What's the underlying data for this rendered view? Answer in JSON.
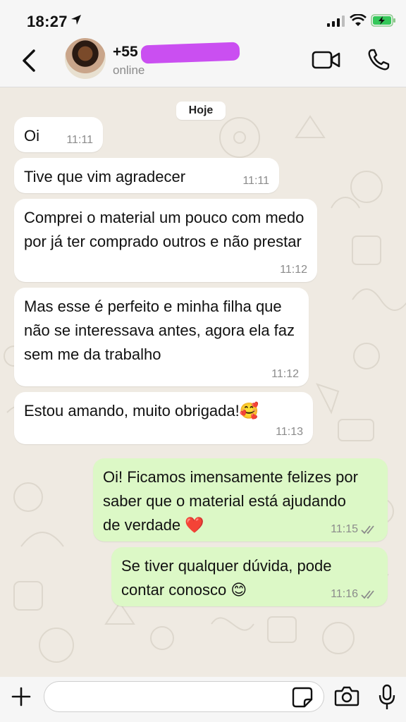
{
  "status_bar": {
    "time": "18:27"
  },
  "header": {
    "contact_name": "+55",
    "contact_status": "online"
  },
  "date_chip": "Hoje",
  "messages": [
    {
      "text": "Oi",
      "time": "11:11",
      "direction": "incoming"
    },
    {
      "text": "Tive que vim agradecer",
      "time": "11:11",
      "direction": "incoming"
    },
    {
      "text": "Comprei o material um pouco com medo por já ter comprado outros e não prestar",
      "time": "11:12",
      "direction": "incoming"
    },
    {
      "text": "Mas esse é perfeito e minha filha que não se interessava antes, agora ela faz sem me da trabalho",
      "time": "11:12",
      "direction": "incoming"
    },
    {
      "text": "Estou amando, muito obrigada!🥰",
      "time": "11:13",
      "direction": "incoming"
    },
    {
      "text": "Oi! Ficamos imensamente felizes por saber que o material está ajudando de verdade ❤️",
      "time": "11:15",
      "direction": "outgoing"
    },
    {
      "text": "Se tiver qualquer dúvida, pode contar conosco 😊",
      "time": "11:16",
      "direction": "outgoing"
    }
  ],
  "input": {
    "placeholder": ""
  },
  "colors": {
    "incoming_bubble": "#ffffff",
    "outgoing_bubble": "#dcf8c6",
    "wallpaper": "#efeae2",
    "read_ticks": "#8b8b8b"
  },
  "icons": [
    "location-arrow-icon",
    "signal-icon",
    "wifi-icon",
    "battery-charging-icon",
    "back-chevron-icon",
    "video-call-icon",
    "phone-icon",
    "plus-icon",
    "sticker-icon",
    "camera-icon",
    "microphone-icon",
    "double-check-icon"
  ]
}
